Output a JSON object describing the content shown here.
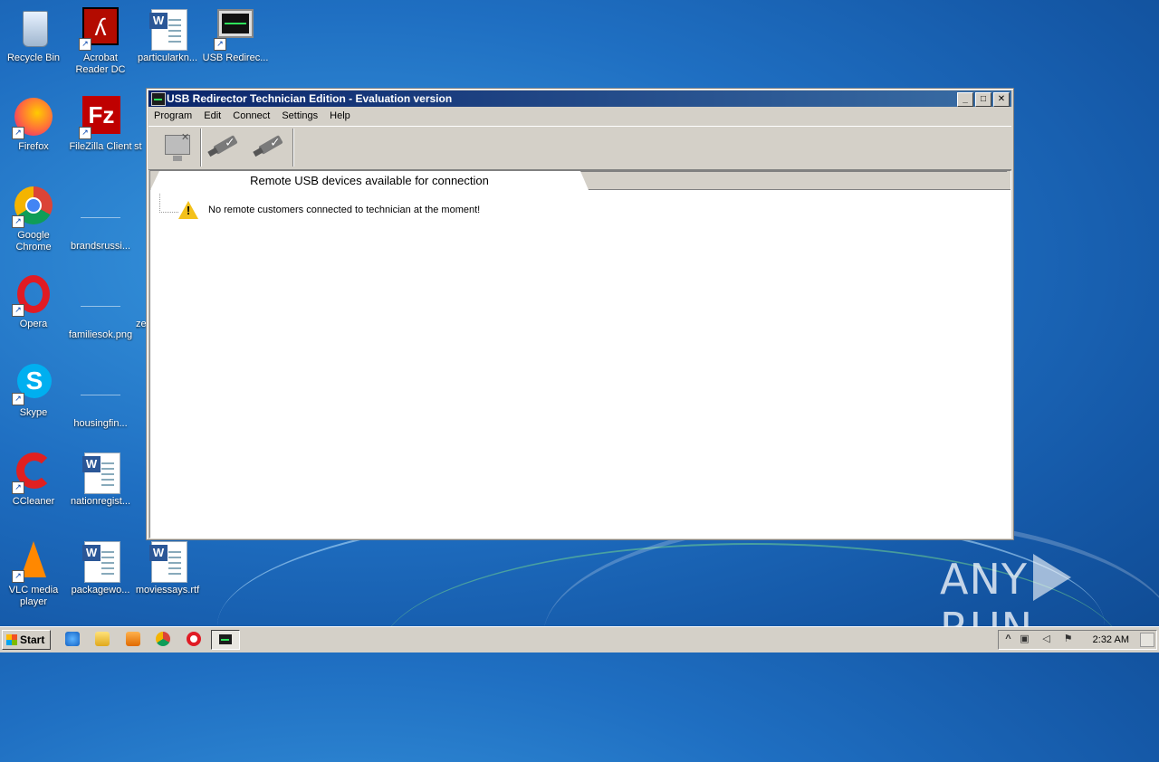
{
  "desktop": {
    "icons": [
      {
        "label": "Recycle Bin"
      },
      {
        "label": "Acrobat Reader DC"
      },
      {
        "label": "particularkn..."
      },
      {
        "label": "USB Redirec..."
      },
      {
        "label": "Firefox"
      },
      {
        "label": "FileZilla Client"
      },
      {
        "label": "st"
      },
      {
        "label": "Google Chrome"
      },
      {
        "label": "brandsrussi..."
      },
      {
        "label": "Opera"
      },
      {
        "label": "familiesok.png"
      },
      {
        "label": "ze"
      },
      {
        "label": "Skype"
      },
      {
        "label": "housingfin..."
      },
      {
        "label": "CCleaner"
      },
      {
        "label": "nationregist..."
      },
      {
        "label": "VLC media player"
      },
      {
        "label": "packagewo..."
      },
      {
        "label": "moviessays.rtf"
      }
    ]
  },
  "window": {
    "title": "USB Redirector Technician Edition - Evaluation version",
    "controls": {
      "minimize": "_",
      "maximize": "□",
      "close": "✕"
    },
    "menu": [
      "Program",
      "Edit",
      "Connect",
      "Settings",
      "Help"
    ],
    "tabs": {
      "active": "Remote USB devices available for connection"
    },
    "message": "No remote customers connected to technician at the moment!",
    "warning_mark": "!"
  },
  "taskbar": {
    "start_label": "Start",
    "clock": "2:32 AM",
    "tray_expand": "^"
  },
  "watermark": {
    "left": "ANY",
    "right": "RUN"
  },
  "colors": {
    "title_gradient_start": "#0a246a",
    "title_gradient_end": "#3a6ea5",
    "chrome": "#d4d0c8",
    "warning": "#f3c11b"
  }
}
